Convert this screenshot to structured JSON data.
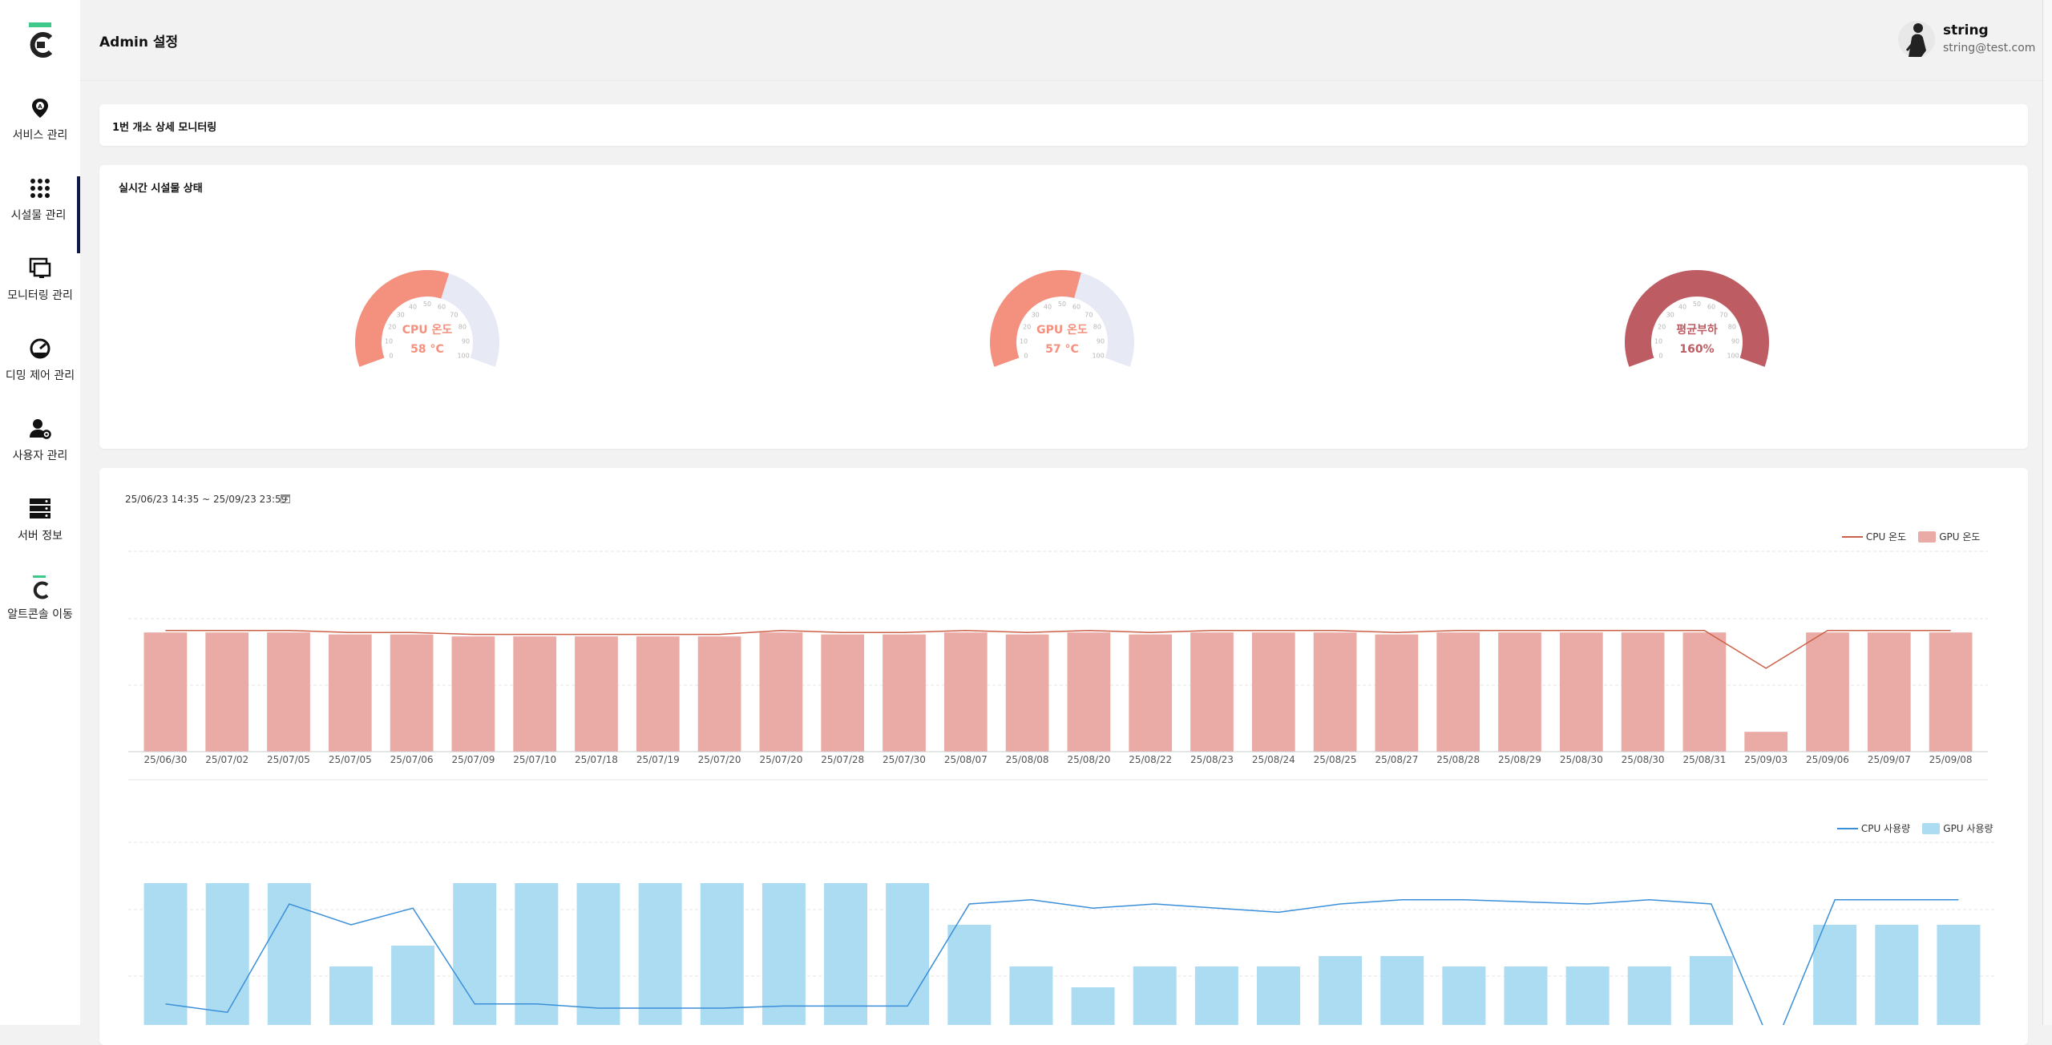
{
  "header": {
    "title": "Admin 설정",
    "user": {
      "name": "string",
      "email": "string@test.com"
    }
  },
  "sidebar": {
    "items": [
      {
        "label": "서비스 관리",
        "icon": "location-pin-icon"
      },
      {
        "label": "시설물 관리",
        "icon": "grid-dots-icon",
        "active": true
      },
      {
        "label": "모니터링 관리",
        "icon": "monitor-icon"
      },
      {
        "label": "디밍 제어 관리",
        "icon": "dimming-icon"
      },
      {
        "label": "사용자 관리",
        "icon": "user-gear-icon"
      },
      {
        "label": "서버 정보",
        "icon": "server-icon"
      },
      {
        "label": "알트콘솔 이동",
        "icon": "console-logo-icon"
      }
    ]
  },
  "breadcrumb_title": "1번 개소 상세 모니터링",
  "status_card": {
    "title": "실시간 시설물 상태"
  },
  "gauges": [
    {
      "label": "CPU 온도",
      "value_text": "58 °C",
      "value": 58,
      "max": 100,
      "color": "#f4907e"
    },
    {
      "label": "GPU 온도",
      "value_text": "57 °C",
      "value": 57,
      "max": 100,
      "color": "#f4907e"
    },
    {
      "label": "평균부하",
      "value_text": "160%",
      "value": 160,
      "max": 100,
      "color": "#be5c63"
    }
  ],
  "gauge_ticks": [
    "0",
    "10",
    "20",
    "30",
    "40",
    "50",
    "60",
    "70",
    "80",
    "90",
    "100"
  ],
  "history": {
    "range": "25/06/23 14:35 ~ 25/09/23 23:59"
  },
  "colors": {
    "cpu_temp": "#cc6048",
    "gpu_temp": "#eaaba7",
    "cpu_usage": "#3a8fd8",
    "gpu_usage": "#acdcf2"
  },
  "chart_data": [
    {
      "type": "bar",
      "legend": [
        "CPU 온도",
        "GPU 온도"
      ],
      "x_tick_labels": [
        "25/06/30",
        "25/07/02",
        "25/07/05",
        "25/07/05",
        "25/07/06",
        "25/07/09",
        "25/07/10",
        "25/07/18",
        "25/07/19",
        "25/07/20",
        "25/07/20",
        "25/07/28",
        "25/07/30",
        "25/08/07",
        "25/08/08",
        "25/08/20",
        "25/08/22",
        "25/08/23",
        "25/08/24",
        "25/08/25",
        "25/08/27",
        "25/08/28",
        "25/08/29",
        "25/08/30",
        "25/08/30",
        "25/08/31",
        "25/09/03",
        "25/09/06",
        "25/09/07",
        "25/09/08"
      ],
      "grid": true,
      "series": [
        {
          "name": "CPU 온도",
          "type": "line",
          "values": [
            61,
            61,
            61,
            60,
            60,
            59,
            59,
            59,
            59,
            59,
            61,
            60,
            60,
            61,
            60,
            61,
            60,
            61,
            61,
            61,
            60,
            61,
            61,
            61,
            61,
            61,
            42,
            61,
            61,
            61
          ]
        },
        {
          "name": "GPU 온도",
          "type": "bar",
          "values": [
            60,
            60,
            60,
            59,
            59,
            58,
            58,
            58,
            58,
            58,
            60,
            59,
            59,
            60,
            59,
            60,
            59,
            60,
            60,
            60,
            59,
            60,
            60,
            60,
            60,
            60,
            10,
            60,
            60,
            60
          ]
        }
      ]
    },
    {
      "type": "bar",
      "legend": [
        "CPU 사용량",
        "GPU 사용량"
      ],
      "grid": true,
      "series": [
        {
          "name": "CPU 사용량",
          "type": "line",
          "values": [
            22,
            18,
            70,
            60,
            68,
            22,
            22,
            20,
            20,
            20,
            21,
            21,
            21,
            70,
            72,
            68,
            70,
            68,
            66,
            70,
            72,
            72,
            71,
            70,
            72,
            70,
            0,
            72,
            72,
            72
          ]
        },
        {
          "name": "GPU 사용량",
          "type": "bar",
          "values": [
            80,
            80,
            80,
            40,
            50,
            80,
            80,
            80,
            80,
            80,
            80,
            80,
            80,
            60,
            40,
            30,
            40,
            40,
            40,
            45,
            45,
            40,
            40,
            40,
            40,
            45,
            0,
            60,
            60,
            60
          ]
        }
      ]
    }
  ]
}
